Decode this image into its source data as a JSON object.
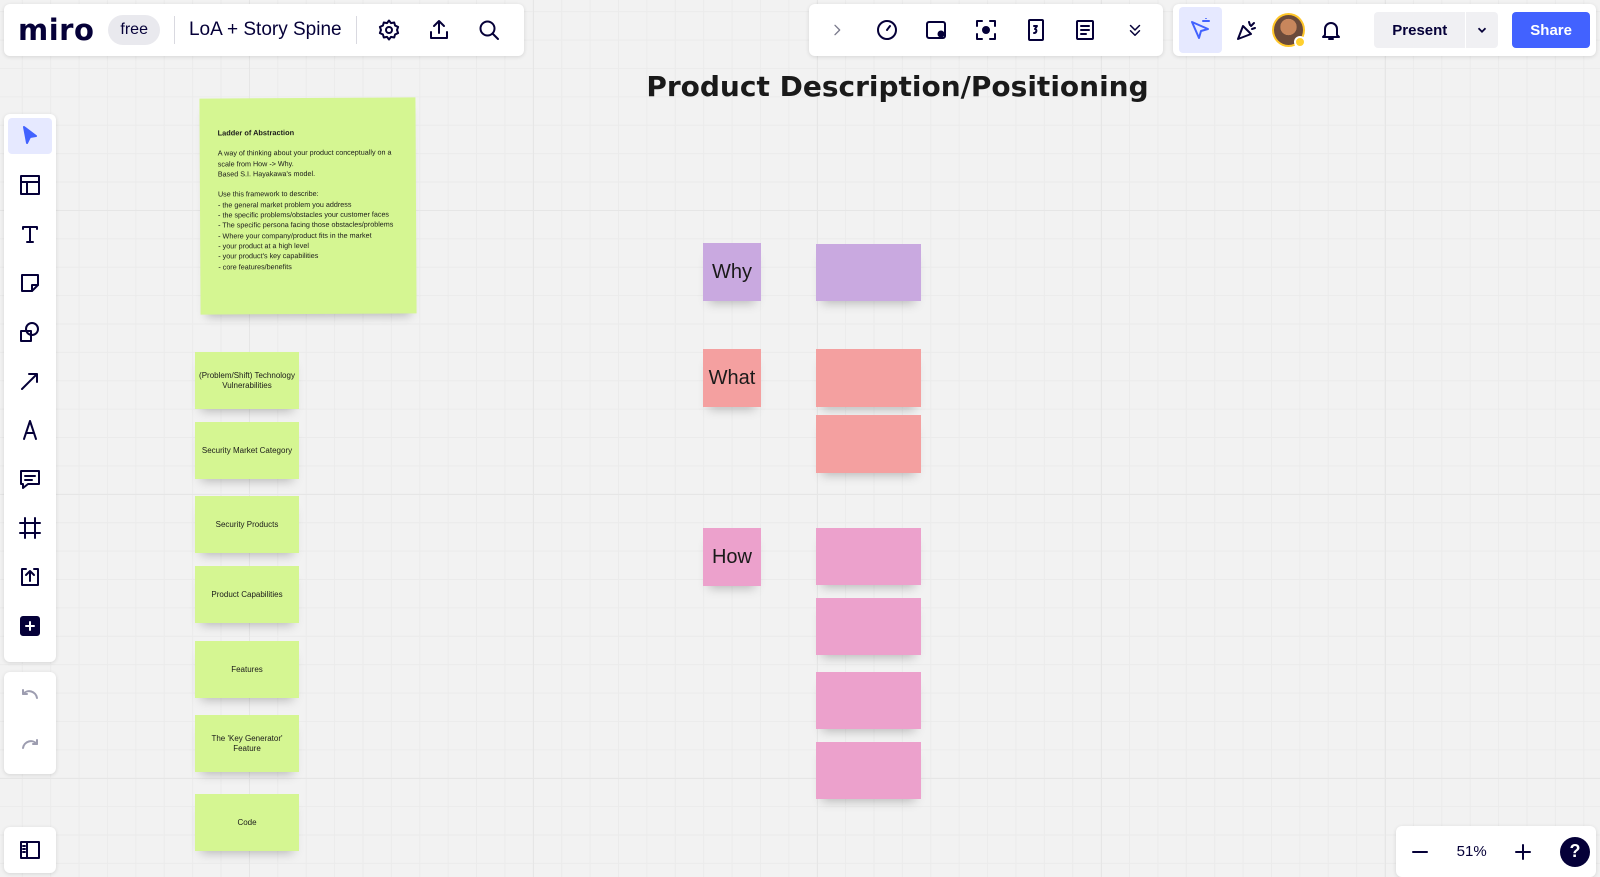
{
  "header": {
    "logo": "miro",
    "plan": "free",
    "board_title": "LoA + Story Spine",
    "present_label": "Present",
    "share_label": "Share"
  },
  "zoom": {
    "level": "51%",
    "help": "?"
  },
  "canvas": {
    "title": "Product Description/Positioning",
    "ladder_note": {
      "title": "Ladder of Abstraction",
      "body": "A way of thinking about your product conceptually on a scale from How -> Why.\nBased S.I. Hayakawa's model.\n\nUse this framework to describe:\n- the general market problem you address\n- the specific problems/obstacles your customer faces\n- The specific persona facing those obstacles/problems\n- Where your company/product fits in the market\n- your product at a high level\n- your product's key capabilities\n- core features/benefits"
    },
    "green_stickies": [
      "(Problem/Shift) Technology Vulnerabilities",
      "Security Market Category",
      "Security Products",
      "Product Capabilities",
      "Features",
      "The 'Key Generator' Feature",
      "Code"
    ],
    "labels": {
      "why": "Why",
      "what": "What",
      "how": "How"
    }
  },
  "colors": {
    "accent": "#4262ff",
    "green_sticky": "#d5f692",
    "purple_sticky": "#c9a9e0",
    "salmon_sticky": "#f4a0a0",
    "pink_sticky": "#eca1cc"
  }
}
